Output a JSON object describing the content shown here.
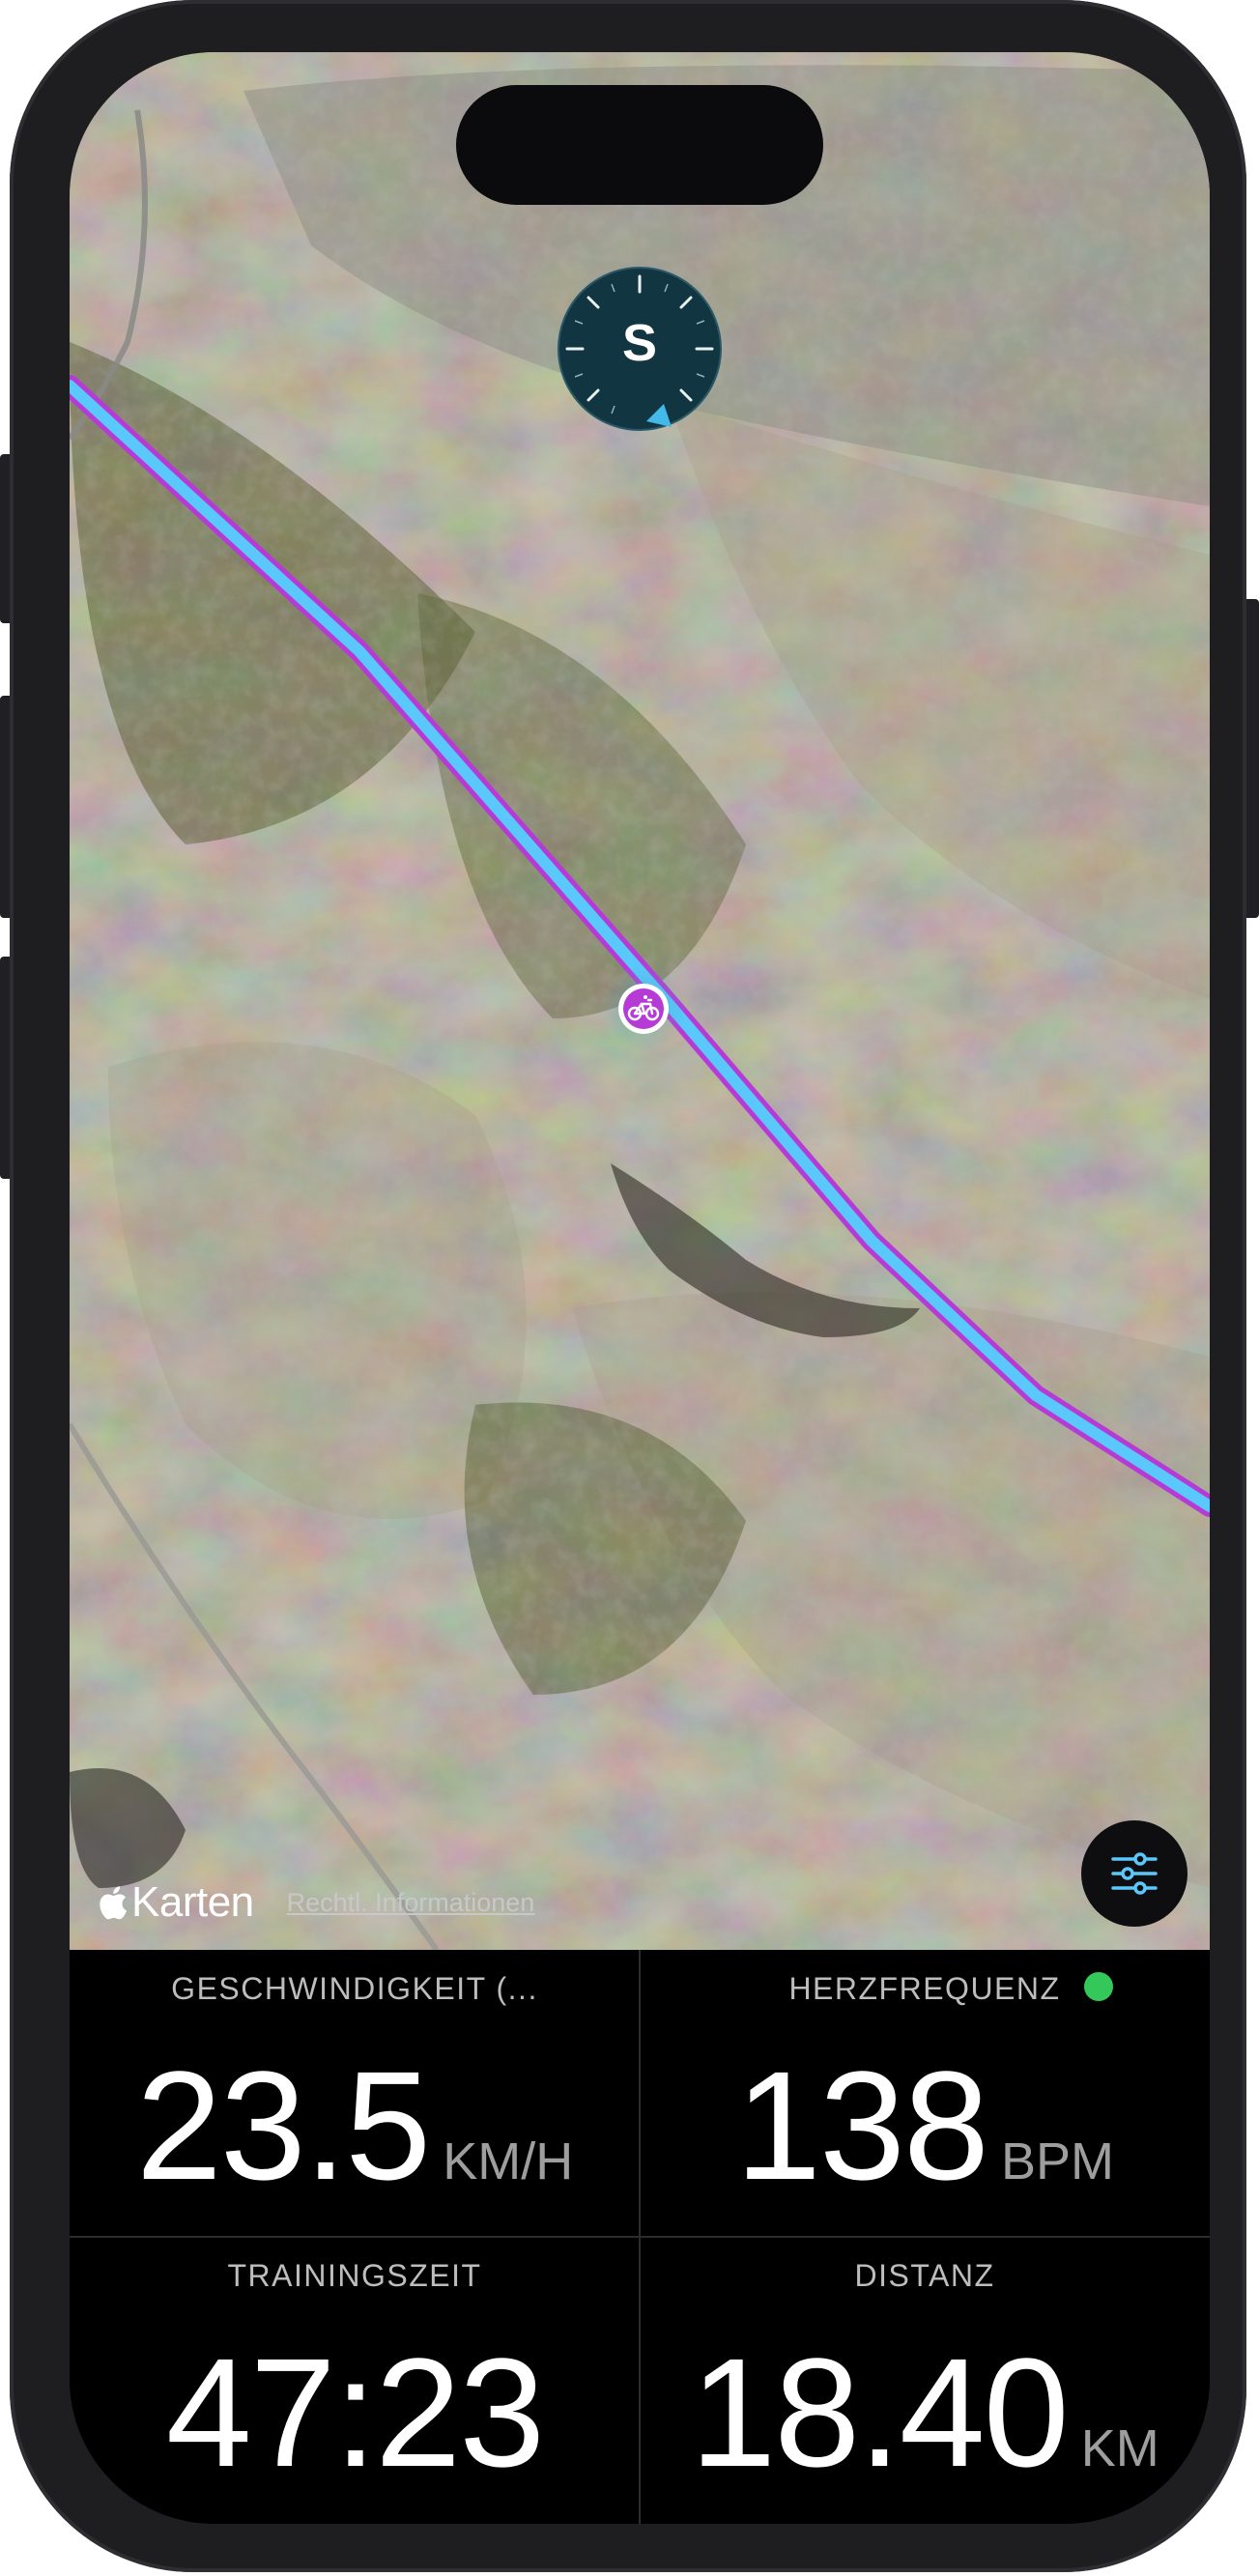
{
  "map": {
    "compass_letter": "S",
    "attribution_brand": "Karten",
    "legal_link": "Rechtl. Informationen",
    "route_color": "#5ac8fa",
    "route_outline_color": "#b63bd6",
    "rider_icon": "bicycle-icon"
  },
  "metrics": [
    {
      "label": "GESCHWINDIGKEIT (...",
      "value": "23.5",
      "unit": "KM/H"
    },
    {
      "label": "HERZFREQUENZ",
      "value": "138",
      "unit": "BPM",
      "status_color": "#34c759"
    },
    {
      "label": "TRAININGSZEIT",
      "value": "47:23",
      "unit": ""
    },
    {
      "label": "DISTANZ",
      "value": "18.40",
      "unit": "KM"
    }
  ]
}
